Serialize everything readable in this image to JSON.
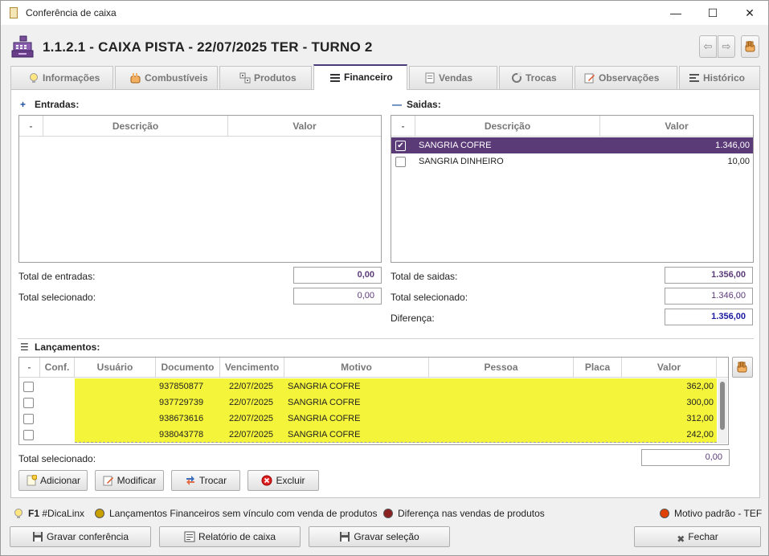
{
  "window": {
    "title": "Conferência de caixa",
    "minimize": "—",
    "maximize": "☐",
    "close": "✕"
  },
  "header": {
    "title": "1.1.2.1 - CAIXA PISTA - 22/07/2025 TER - TURNO 2",
    "prev": "⇦",
    "next": "⇨"
  },
  "tabs": [
    {
      "label": "Informações",
      "icon": "lightbulb-icon"
    },
    {
      "label": "Combustíveis",
      "icon": "hand-icon"
    },
    {
      "label": "Produtos",
      "icon": "dice-icon"
    },
    {
      "label": "Financeiro",
      "icon": "lines-icon",
      "active": true
    },
    {
      "label": "Vendas",
      "icon": "document-icon"
    },
    {
      "label": "Trocas",
      "icon": "refresh-icon"
    },
    {
      "label": "Observações",
      "icon": "pencil-icon"
    },
    {
      "label": "Histórico",
      "icon": "history-icon"
    }
  ],
  "entradas": {
    "label": "Entradas:",
    "symbol": "+",
    "columns": [
      "-",
      "Descrição",
      "Valor"
    ],
    "rows": []
  },
  "saidas": {
    "label": "Saidas:",
    "symbol": "—",
    "columns": [
      "-",
      "Descrição",
      "Valor"
    ],
    "rows": [
      {
        "checked": true,
        "descricao": "SANGRIA COFRE",
        "valor": "1.346,00"
      },
      {
        "checked": false,
        "descricao": "SANGRIA DINHEIRO",
        "valor": "10,00"
      }
    ]
  },
  "totais_entradas": {
    "total_label": "Total de entradas:",
    "total_value": "0,00",
    "selecionado_label": "Total selecionado:",
    "selecionado_value": "0,00"
  },
  "totais_saidas": {
    "total_label": "Total de saidas:",
    "total_value": "1.356,00",
    "selecionado_label": "Total selecionado:",
    "selecionado_value": "1.346,00",
    "diferenca_label": "Diferença:",
    "diferenca_value": "1.356,00"
  },
  "lancamentos": {
    "label": "Lançamentos:",
    "columns": [
      "-",
      "Conf.",
      "Usuário",
      "Documento",
      "Vencimento",
      "Motivo",
      "Pessoa",
      "Placa",
      "Valor"
    ],
    "rows": [
      {
        "documento": "937850877",
        "vencimento": "22/07/2025",
        "motivo": "SANGRIA COFRE",
        "valor": "362,00"
      },
      {
        "documento": "937729739",
        "vencimento": "22/07/2025",
        "motivo": "SANGRIA COFRE",
        "valor": "300,00"
      },
      {
        "documento": "938673616",
        "vencimento": "22/07/2025",
        "motivo": "SANGRIA COFRE",
        "valor": "312,00"
      },
      {
        "documento": "938043778",
        "vencimento": "22/07/2025",
        "motivo": "SANGRIA COFRE",
        "valor": "242,00"
      }
    ],
    "total_label": "Total selecionado:",
    "total_value": "0,00"
  },
  "actions": {
    "adicionar": "Adicionar",
    "modificar": "Modificar",
    "trocar": "Trocar",
    "excluir": "Excluir"
  },
  "status_bar": {
    "hint_key": "F1",
    "hint_text": "#DicaLinx",
    "legend1": "Lançamentos Financeiros sem vínculo com venda de produtos",
    "legend2": "Diferença nas vendas de produtos",
    "legend3": "Motivo padrão - TEF",
    "colors": {
      "legend1": "#c8a000",
      "legend2": "#8a2020",
      "legend3": "#e04000"
    }
  },
  "footer": {
    "gravar_conferencia": "Gravar conferência",
    "relatorio": "Relatório de caixa",
    "gravar_selecao": "Gravar seleção",
    "fechar": "Fechar"
  },
  "colors": {
    "accent": "#5b3a78",
    "highlight_row": "#f4f43a",
    "blue_value": "#1a1aa0"
  }
}
